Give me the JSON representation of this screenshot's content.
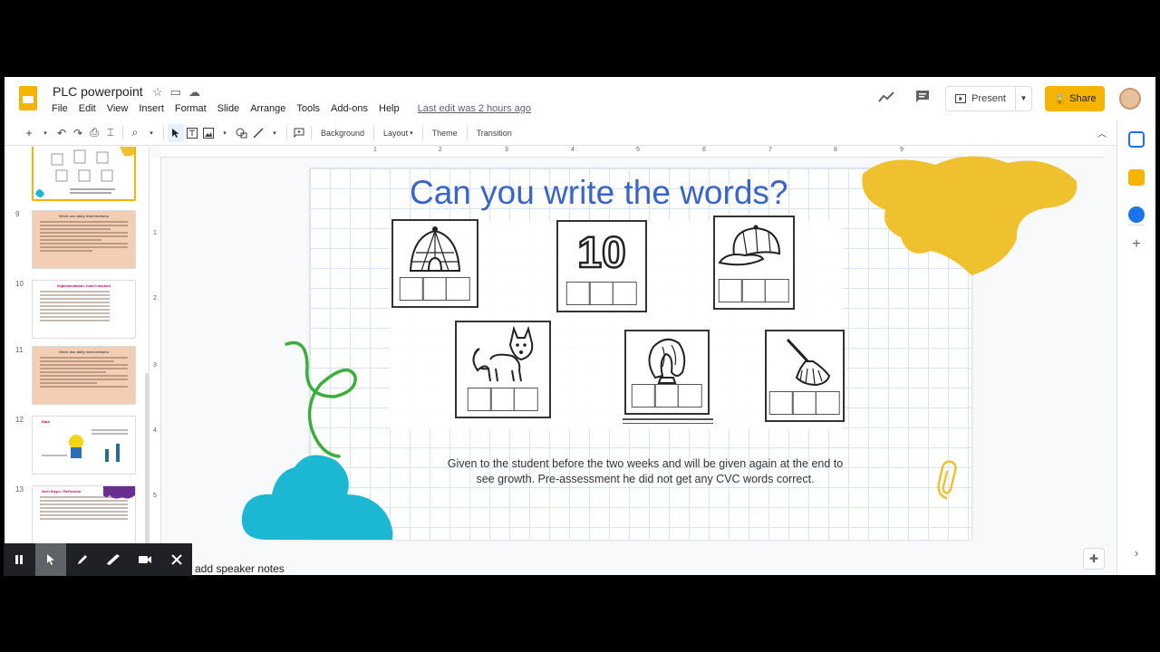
{
  "header": {
    "doc_title": "PLC powerpoint",
    "menu": [
      "File",
      "Edit",
      "View",
      "Insert",
      "Format",
      "Slide",
      "Arrange",
      "Tools",
      "Add-ons",
      "Help"
    ],
    "last_edit": "Last edit was 2 hours ago",
    "present_label": "Present",
    "share_label": "Share"
  },
  "toolbar": {
    "background_label": "Background",
    "layout_label": "Layout",
    "theme_label": "Theme",
    "transition_label": "Transition"
  },
  "filmstrip": {
    "slides": [
      {
        "num": "9",
        "title": "Week one daily interventions"
      },
      {
        "num": "10",
        "title": "Implementation: how it worked"
      },
      {
        "num": "11",
        "title": "Week two daily interventions"
      },
      {
        "num": "12",
        "title": "Data"
      },
      {
        "num": "13",
        "title": "Next Steps / Reflection"
      }
    ]
  },
  "ruler": {
    "top": [
      "1",
      "2",
      "3",
      "4",
      "5",
      "6",
      "7",
      "8",
      "9"
    ],
    "left": [
      "1",
      "2",
      "3",
      "4",
      "5"
    ]
  },
  "slide": {
    "title": "Can you write the words?",
    "caption": "Given to the student before the two weeks and will be given again at the end to see growth. Pre-assessment he did not get any CVC words correct.",
    "card_number": "10",
    "colors": {
      "title": "#3a64c8",
      "splat_yellow": "#f0c12e",
      "splat_teal": "#1bb7d3",
      "squiggle_green": "#3cae3c"
    }
  },
  "notes": {
    "placeholder": "o add speaker notes"
  },
  "accent": "#f4b400"
}
